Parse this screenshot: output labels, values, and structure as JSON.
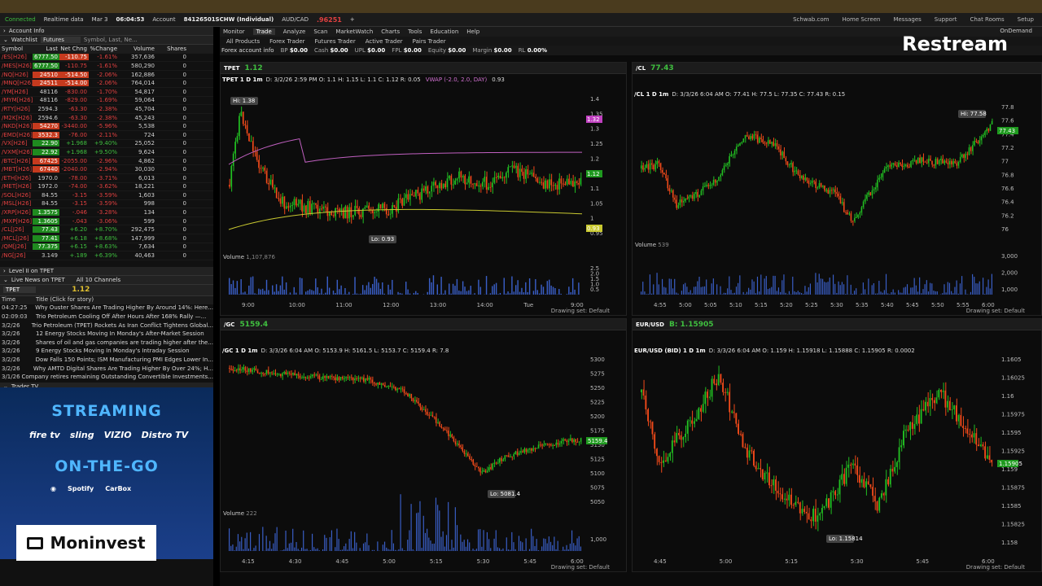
{
  "status": {
    "connected": "Connected",
    "realtime": "Realtime data",
    "date": "Mar 3",
    "time": "06:04:53",
    "account_label": "Account",
    "account": "84126501SCHW (Individual)",
    "pair": "AUD/CAD",
    "pair_price": ".96251",
    "links": [
      "Schwab.com",
      "Home Screen",
      "Messages",
      "Support",
      "Chat Rooms",
      "Setup"
    ]
  },
  "left": {
    "account_info": "Account Info",
    "watchlist_label": "Watchlist",
    "watchlist_select": "Futures",
    "search_placeholder": "Symbol, Last, Ne...",
    "headers": [
      "Symbol",
      "Last",
      "Net Chng",
      "%Change",
      "Volume",
      "Shares"
    ],
    "rows": [
      [
        "/ES[H26]",
        "6777.50",
        "-110.75",
        "-1.61%",
        "357,636",
        "0"
      ],
      [
        "/MES[H26]",
        "6777.50",
        "-110.75",
        "-1.61%",
        "580,290",
        "0"
      ],
      [
        "/NQ[H26]",
        "24510",
        "-514.50",
        "-2.06%",
        "162,886",
        "0"
      ],
      [
        "/MNQ[H26]",
        "24511",
        "-514.00",
        "-2.06%",
        "764,014",
        "0"
      ],
      [
        "/YM[H26]",
        "48116",
        "-830.00",
        "-1.70%",
        "54,817",
        "0"
      ],
      [
        "/MYM[H26]",
        "48116",
        "-829.00",
        "-1.69%",
        "59,064",
        "0"
      ],
      [
        "/RTY[H26]",
        "2594.3",
        "-63.30",
        "-2.38%",
        "45,704",
        "0"
      ],
      [
        "/M2K[H26]",
        "2594.6",
        "-63.30",
        "-2.38%",
        "45,243",
        "0"
      ],
      [
        "/NKD[H26]",
        "54270",
        "-3440.00",
        "-5.96%",
        "5,538",
        "0"
      ],
      [
        "/EMD[H26]",
        "3532.3",
        "-76.00",
        "-2.11%",
        "724",
        "0"
      ],
      [
        "/VX[H26]",
        "22.90",
        "+1.968",
        "+9.40%",
        "25,052",
        "0"
      ],
      [
        "/VXM[H26]",
        "22.92",
        "+1.968",
        "+9.50%",
        "9,624",
        "0"
      ],
      [
        "/BTC[H26]",
        "67425",
        "-2055.00",
        "-2.96%",
        "4,862",
        "0"
      ],
      [
        "/MBT[H26]",
        "67440",
        "-2040.00",
        "-2.94%",
        "30,030",
        "0"
      ],
      [
        "/ETH[H26]",
        "1970.0",
        "-78.00",
        "-3.71%",
        "6,013",
        "0"
      ],
      [
        "/MET[H26]",
        "1972.0",
        "-74.00",
        "-3.62%",
        "18,221",
        "0"
      ],
      [
        "/SOL[H26]",
        "84.55",
        "-3.15",
        "-3.59%",
        "1,603",
        "0"
      ],
      [
        "/MSL[H26]",
        "84.55",
        "-3.15",
        "-3.59%",
        "998",
        "0"
      ],
      [
        "/XRP[H26]",
        "1.3575",
        "-.046",
        "-3.28%",
        "134",
        "0"
      ],
      [
        "/MXP[H26]",
        "1.3605",
        "-.043",
        "-3.06%",
        "599",
        "0"
      ],
      [
        "/CL[J26]",
        "77.43",
        "+6.20",
        "+8.70%",
        "292,475",
        "0"
      ],
      [
        "/MCL[J26]",
        "77.41",
        "+6.18",
        "+8.68%",
        "147,999",
        "0"
      ],
      [
        "/QM[J26]",
        "77.375",
        "+6.15",
        "+8.63%",
        "7,634",
        "0"
      ],
      [
        "/NG[J26]",
        "3.149",
        "+.189",
        "+6.39%",
        "40,463",
        "0"
      ]
    ],
    "level2": "Level II on TPET",
    "news_title": "Live News on TPET",
    "news_channels": "All 10 Channels",
    "news_symbol": "TPET",
    "news_price": "1.12",
    "news_headers": [
      "Time",
      "Title (Click for story)"
    ],
    "news": [
      [
        "04:27:25",
        "Why Ouster Shares Are Trading Higher By Around 14%: Here..."
      ],
      [
        "02:09:03",
        "Trio Petroleum Cooling Off After Hours After 168% Rally —..."
      ],
      [
        "3/2/26",
        "Trio Petroleum (TPET) Rockets As Iran Conflict Tightens Global..."
      ],
      [
        "3/2/26",
        "12 Energy Stocks Moving In Monday's After-Market Session"
      ],
      [
        "3/2/26",
        "Shares of oil and gas companies are trading higher after the..."
      ],
      [
        "3/2/26",
        "9 Energy Stocks Moving In Monday's Intraday Session"
      ],
      [
        "3/2/26",
        "Dow Falls 150 Points; ISM Manufacturing PMI Edges Lower In..."
      ],
      [
        "3/2/26",
        "Why AMTD Digital Shares Are Trading Higher By Over 24%; H..."
      ],
      [
        "3/1/26",
        "Company retires remaining Outstanding Convertible Investments..."
      ]
    ],
    "trader_tv": "Trader TV",
    "promo": {
      "streaming": "STREAMING",
      "brands": [
        "fire tv",
        "sling",
        "VIZIO",
        "Distro TV"
      ],
      "onthego": "ON-THE-GO",
      "apps": [
        "Spotify",
        "CarBox"
      ]
    },
    "moninvest": "Moninvest"
  },
  "main": {
    "tabs": [
      "Monitor",
      "Trade",
      "Analyze",
      "Scan",
      "MarketWatch",
      "Charts",
      "Tools",
      "Education",
      "Help"
    ],
    "active_tab": "Trade",
    "ondemand": "OnDemand",
    "subtabs": [
      "All Products",
      "Forex Trader",
      "Futures Trader",
      "Active Trader",
      "Pairs Trader"
    ],
    "forex_info": "Forex account info",
    "acct_fields": [
      [
        "BP",
        "$0.00"
      ],
      [
        "Cash",
        "$0.00"
      ],
      [
        "UPL",
        "$0.00"
      ],
      [
        "FPL",
        "$0.00"
      ],
      [
        "Equity",
        "$0.00"
      ],
      [
        "Margin",
        "$0.00"
      ],
      [
        "RL",
        "0.00%"
      ]
    ],
    "restream": "Restream",
    "drawing_set": "Drawing set: Default"
  },
  "charts": [
    {
      "symbol": "TPET",
      "last": "1.12",
      "period": "TPET 1 D 1m",
      "info": "D: 3/2/26 2:59 PM  O: 1.1  H: 1.15  L: 1.1  C: 1.12  R: 0.05",
      "study": "VWAP (-2.0, 2.0, DAY)",
      "study_val": "0.93",
      "hi": "Hi: 1.38",
      "lo": "Lo: 0.93",
      "volume": "Volume",
      "volume_val": "1,107,876",
      "y_ticks": [
        "1.4",
        "1.35",
        "1.3",
        "1.25",
        "1.2",
        "1.15",
        "1.1",
        "1.05",
        "1",
        "0.95"
      ],
      "y_tags": [
        "1.32",
        "1.12",
        "0.93"
      ],
      "x_ticks": [
        "9:00",
        "10:00",
        "11:00",
        "12:00",
        "13:00",
        "14:00",
        "Tue",
        "9:00"
      ],
      "vol_ticks": [
        "2.5",
        "2.0",
        "1.5",
        "1.0",
        "0.5"
      ],
      "vol_unit": "millions"
    },
    {
      "symbol": "/CL",
      "last": "77.43",
      "period": "/CL 1 D 1m",
      "info": "D: 3/3/26 6:04 AM  O: 77.41  H: 77.5  L: 77.35  C: 77.43  R: 0.15",
      "hi": "Hi: 77.58",
      "volume": "Volume",
      "volume_val": "539",
      "y_ticks": [
        "77.8",
        "77.6",
        "77.4",
        "77.2",
        "77",
        "76.8",
        "76.6",
        "76.4",
        "76.2",
        "76"
      ],
      "y_tag": "77.43",
      "x_ticks": [
        "4:55",
        "5:00",
        "5:05",
        "5:10",
        "5:15",
        "5:20",
        "5:25",
        "5:30",
        "5:35",
        "5:40",
        "5:45",
        "5:50",
        "5:55",
        "6:00"
      ],
      "vol_ticks": [
        "3,000",
        "2,000",
        "1,000"
      ]
    },
    {
      "symbol": "/GC",
      "last": "5159.4",
      "period": "/GC 1 D 1m",
      "info": "D: 3/3/26 6:04 AM  O: 5153.9  H: 5161.5  L: 5153.7  C: 5159.4  R: 7.8",
      "lo": "Lo: 5081.4",
      "volume": "Volume",
      "volume_val": "222",
      "y_ticks": [
        "5300",
        "5275",
        "5250",
        "5225",
        "5200",
        "5175",
        "5150",
        "5125",
        "5100",
        "5075",
        "5050"
      ],
      "y_tag": "5159.4",
      "x_ticks": [
        "4:15",
        "4:30",
        "4:45",
        "5:00",
        "5:15",
        "5:30",
        "5:45",
        "6:00"
      ],
      "vol_ticks": [
        "1,000"
      ]
    },
    {
      "symbol": "EUR/USD",
      "last": "B: 1.15905",
      "period": "EUR/USD (BID) 1 D 1m",
      "info": "D: 3/3/26 6:04 AM  O: 1.159  H: 1.15918  L: 1.15888  C: 1.15905  R: 0.0002",
      "lo": "Lo: 1.15814",
      "y_ticks": [
        "1.1605",
        "1.16025",
        "1.16",
        "1.15975",
        "1.1595",
        "1.15925",
        "1.159",
        "1.15875",
        "1.1585",
        "1.15825",
        "1.158"
      ],
      "y_tag": "1.15905",
      "x_ticks": [
        "4:45",
        "5:00",
        "5:15",
        "5:30",
        "5:45",
        "6:00"
      ]
    }
  ],
  "colors": {
    "up": "#22c022",
    "down": "#f04a1a",
    "accent": "#3fbf3f",
    "negative": "#e04040"
  }
}
